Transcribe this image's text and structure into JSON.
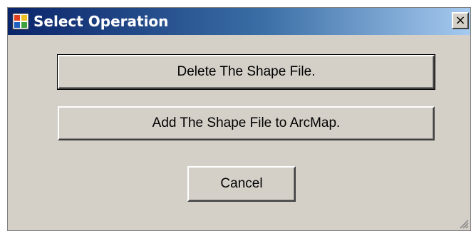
{
  "window": {
    "title": "Select Operation",
    "app_icon": "window-app-icon",
    "close_glyph": "×"
  },
  "buttons": {
    "delete_label": "Delete The Shape File.",
    "add_label": "Add The Shape File to ArcMap.",
    "cancel_label": "Cancel"
  },
  "colors": {
    "titlebar_start": "#0a246a",
    "titlebar_end": "#a6caf0",
    "dialog_face": "#d4d0c8"
  }
}
